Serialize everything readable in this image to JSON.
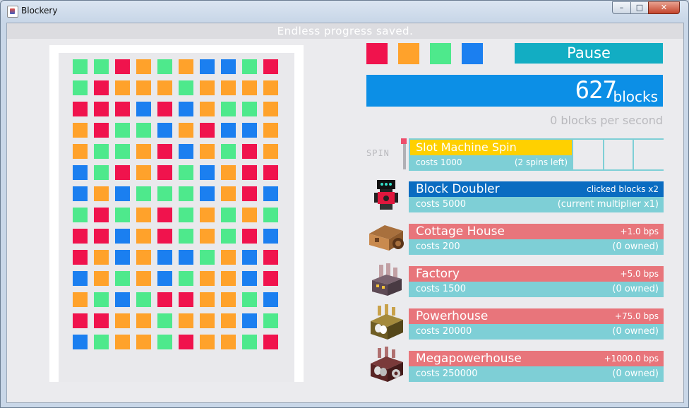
{
  "window": {
    "title": "Blockery",
    "min_icon": "minimize-icon",
    "max_icon": "maximize-icon",
    "close_icon": "close-icon",
    "min_glyph": "–",
    "max_glyph": "□",
    "close_glyph": "✕"
  },
  "status": "Endless progress saved.",
  "palette": {
    "red": "#f0134d",
    "orange": "#ffa22b",
    "green": "#4ee98c",
    "blue": "#1b7ff0"
  },
  "color_swatches": [
    "red",
    "orange",
    "green",
    "blue"
  ],
  "pause_label": "Pause",
  "counter": {
    "value": "627",
    "unit": "blocks"
  },
  "rate_text": "0 blocks per second",
  "slot": {
    "side_label": "SPIN",
    "title": "Slot Machine Spin",
    "cost": "costs 1000",
    "spins_left": "(2 spins left)"
  },
  "items": [
    {
      "name": "Block Doubler",
      "effect": "clicked blocks x2",
      "cost": "costs 5000",
      "status": "(current multiplier x1)",
      "title_color": "#0a6cc1",
      "icon": "robot-icon"
    },
    {
      "name": "Cottage House",
      "effect": "+1.0 bps",
      "cost": "costs 200",
      "status": "(0 owned)",
      "title_color": "#e8757b",
      "icon": "cottage-icon"
    },
    {
      "name": "Factory",
      "effect": "+5.0 bps",
      "cost": "costs 1500",
      "status": "(0 owned)",
      "title_color": "#e8757b",
      "icon": "factory-icon"
    },
    {
      "name": "Powerhouse",
      "effect": "+75.0 bps",
      "cost": "costs 20000",
      "status": "(0 owned)",
      "title_color": "#e8757b",
      "icon": "powerhouse-icon"
    },
    {
      "name": "Megapowerhouse",
      "effect": "+1000.0 bps",
      "cost": "costs 250000",
      "status": "(0 owned)",
      "title_color": "#e8757b",
      "icon": "megapowerhouse-icon"
    }
  ],
  "board": [
    "GGRO GOBBGR",
    "GROOOGOOOO",
    "RRRBRBOGGO",
    "ORGGBORBBO",
    "OGGORBOGRO",
    "BGRORGBORR",
    "BOBGGGBORB",
    "GRGORGOGOG",
    "RRBORGOGRB",
    "ROBOBBGOBR",
    "BOGOBGOOBR",
    "OGBGRROOGB",
    "RROOGOOOBG",
    "BGOOGROOGR"
  ]
}
